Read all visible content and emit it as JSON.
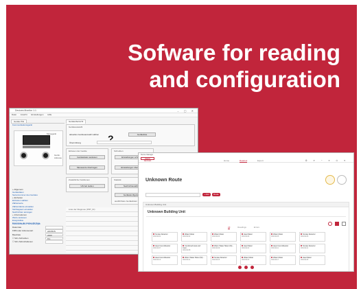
{
  "headline": {
    "line1": "Sofware for reading",
    "line2": "and configuration"
  },
  "colors": {
    "brand_red": "#c1253b",
    "background": "#ffffff"
  },
  "legacy_app": {
    "title": "Devices Monitor 1.1",
    "window_controls": "– ▢ ✕",
    "menu": [
      "Datei",
      "Ansicht",
      "Einstellungen",
      "Hilfe"
    ],
    "left_tab": "Geräte PIH",
    "left_sub": "Kommunikationsgerät",
    "device_label": "Messgerät",
    "device_label2": "Gerät-Adresse",
    "tree": [
      {
        "text": "+ Allgemein",
        "section": true
      },
      {
        "text": "Gerätedaten",
        "section": false
      },
      {
        "text": "Seriennummer des Gerätes",
        "section": false
      },
      {
        "text": "+ Einheiten",
        "section": true
      },
      {
        "text": "Einheiten wählen",
        "section": false
      },
      {
        "text": "Zählerwerte",
        "section": false
      },
      {
        "text": "Zählerstände einstellen",
        "section": false
      },
      {
        "text": "Stichtagwert einstellen",
        "section": false
      },
      {
        "text": "Nachrichten anzeigen",
        "section": false
      },
      {
        "text": "+ Informationen",
        "section": true
      },
      {
        "text": "Werte auslesen",
        "section": false
      },
      {
        "text": "Ereignisliste",
        "section": false
      },
      {
        "text": "Ereignisse der letzten 60 Tage",
        "section": false
      }
    ],
    "params_header": "Kommunikation / Einstellungen",
    "params": [
      {
        "label": "Datenrate",
        "value": "",
        "aux": ""
      },
      {
        "label": "FRM oder Adressenart",
        "value": "wM-BUS",
        "aux": ""
      },
      {
        "label": "Baudrate",
        "value": "2400",
        "aux": ""
      },
      {
        "label": "☐ Wm-Schreiben",
        "value": "Dis",
        "aux": ""
      },
      {
        "label": "☐ Wm-Störschaltenen",
        "value": "",
        "aux": ""
      }
    ],
    "right_tab": "Geräteübersicht",
    "panel_top_caption": "Geräteauswahl",
    "device_select_label": "aktuelles Geräteauswahl wählen",
    "device_select_button": "Geräteliste",
    "status_label": "Übermittlung",
    "panel_read_caption": "Einlesen der Geräte",
    "btn_read": "Gerätedaten auslesen",
    "btn_read_store": "Messwerte übertragen",
    "panel_write_caption": "Schreiben",
    "btn_write": "Einstellungen schreiben",
    "btn_write_store": "Einstellungen übertragen",
    "panel_aux_caption": "Zusätzliche Funktionen",
    "btn_aux": "Uhrzeit stellen",
    "btn_aux2": "Nachrichtenabfrage",
    "panel_aux2_caption": "Statistik",
    "btn_aux3": "Gerätekonfigurieren",
    "note": "Liste der Diagnose (PRT_ID)",
    "status_row": "ausführbare Gerätelisten"
  },
  "modern_app": {
    "logo": "Device Manager",
    "logo_badge": "RADIO DEVICES",
    "nav": [
      {
        "label": "Home",
        "active": false
      },
      {
        "label": "Readout",
        "active": true
      },
      {
        "label": "Export",
        "active": false
      }
    ],
    "tools": "⚙ ▾ ◔ ▾ ⊙ ▾",
    "route_title": "Unknown Route",
    "search_placeholder": "",
    "btn_add": "+ Add",
    "btn_route": "Route",
    "card_header": "Unknown Building Unit",
    "unit_title": "Unknown Building Unit",
    "tabs": [
      {
        "label": "All",
        "active": true
      },
      {
        "label": "Readings",
        "active": false
      },
      {
        "label": "Errors",
        "active": false
      }
    ],
    "tiles": [
      {
        "title": "Smoke Detector",
        "sub": "00321101"
      },
      {
        "title": "Water Meter",
        "sub": "00321102"
      },
      {
        "title": "Water Meter",
        "sub": "00321103"
      },
      {
        "title": "Heat Meter",
        "sub": "00321104"
      },
      {
        "title": "Water Meter",
        "sub": "00321105"
      },
      {
        "title": "Smoke Detector",
        "sub": "00321106"
      },
      {
        "title": "Heat Cost Allocator",
        "sub": "00321107"
      },
      {
        "title": "Combined Heat and Cool...",
        "sub": "00321108"
      },
      {
        "title": "Warm Water Meter (M)...",
        "sub": "00321109"
      },
      {
        "title": "Heat Meter",
        "sub": "00321110"
      },
      {
        "title": "Heat Cost Allocator",
        "sub": "00321111"
      },
      {
        "title": "Smoke Detector",
        "sub": "00321112"
      },
      {
        "title": "Heat Cost Allocator",
        "sub": "00321113"
      },
      {
        "title": "Warm Water Meter (M)...",
        "sub": "00321114"
      },
      {
        "title": "Smoke Detector",
        "sub": "00321115"
      },
      {
        "title": "Water Meter",
        "sub": "00321116"
      },
      {
        "title": "Water Meter",
        "sub": "00321117"
      },
      {
        "title": "Heat Meter",
        "sub": "00321118"
      }
    ]
  }
}
